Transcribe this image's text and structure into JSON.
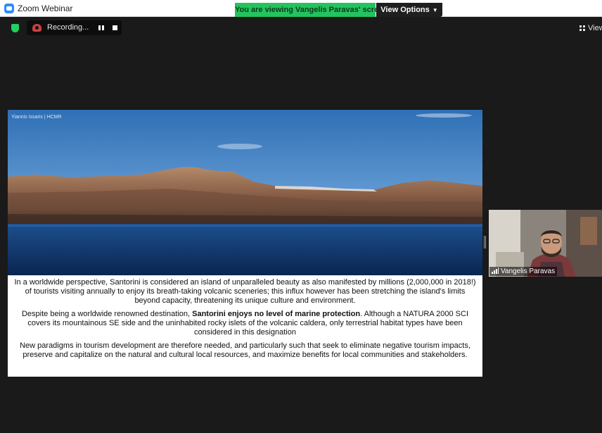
{
  "window": {
    "title": "Zoom Webinar"
  },
  "share_banner": {
    "text": "You are viewing Vangelis Paravas' screen",
    "view_options_label": "View Options"
  },
  "toolbar": {
    "recording_label": "Recording...",
    "view_label": "View"
  },
  "slide": {
    "credit": "Yiannis Issaris | HCMR",
    "paragraph_1": "In a worldwide perspective, Santorini is considered an island of unparalleled beauty as also manifested by millions (2,000,000 in 2018!) of tourists visiting annually to enjoy its breath-taking volcanic sceneries; this influx however has been stretching the island's limits beyond capacity, threatening its unique culture and environment.",
    "paragraph_2_before": "Despite being a worldwide renowned destination, ",
    "paragraph_2_bold": "Santorini enjoys no level of marine protection",
    "paragraph_2_after": ". Although a NATURA 2000 SCI covers its mountainous SE side and the uninhabited rocky islets of the volcanic caldera, only terrestrial habitat types have been considered in this designation",
    "paragraph_3": "New paradigms in tourism development are therefore needed, and particularly such that seek to eliminate negative tourism impacts, preserve and capitalize on the natural and cultural local resources, and maximize benefits for local communities and stakeholders."
  },
  "participant": {
    "name": "Vangelis Paravas"
  },
  "colors": {
    "banner_green": "#23c45e",
    "background": "#1a1a1a",
    "recording_red": "#c9423f",
    "shield_green": "#23d160"
  },
  "icons": {
    "app": "zoom-logo-icon",
    "security": "shield-icon",
    "recording": "cloud-record-icon",
    "pause": "pause-icon",
    "stop": "stop-icon",
    "view": "grid-icon",
    "signal": "signal-bars-icon"
  }
}
